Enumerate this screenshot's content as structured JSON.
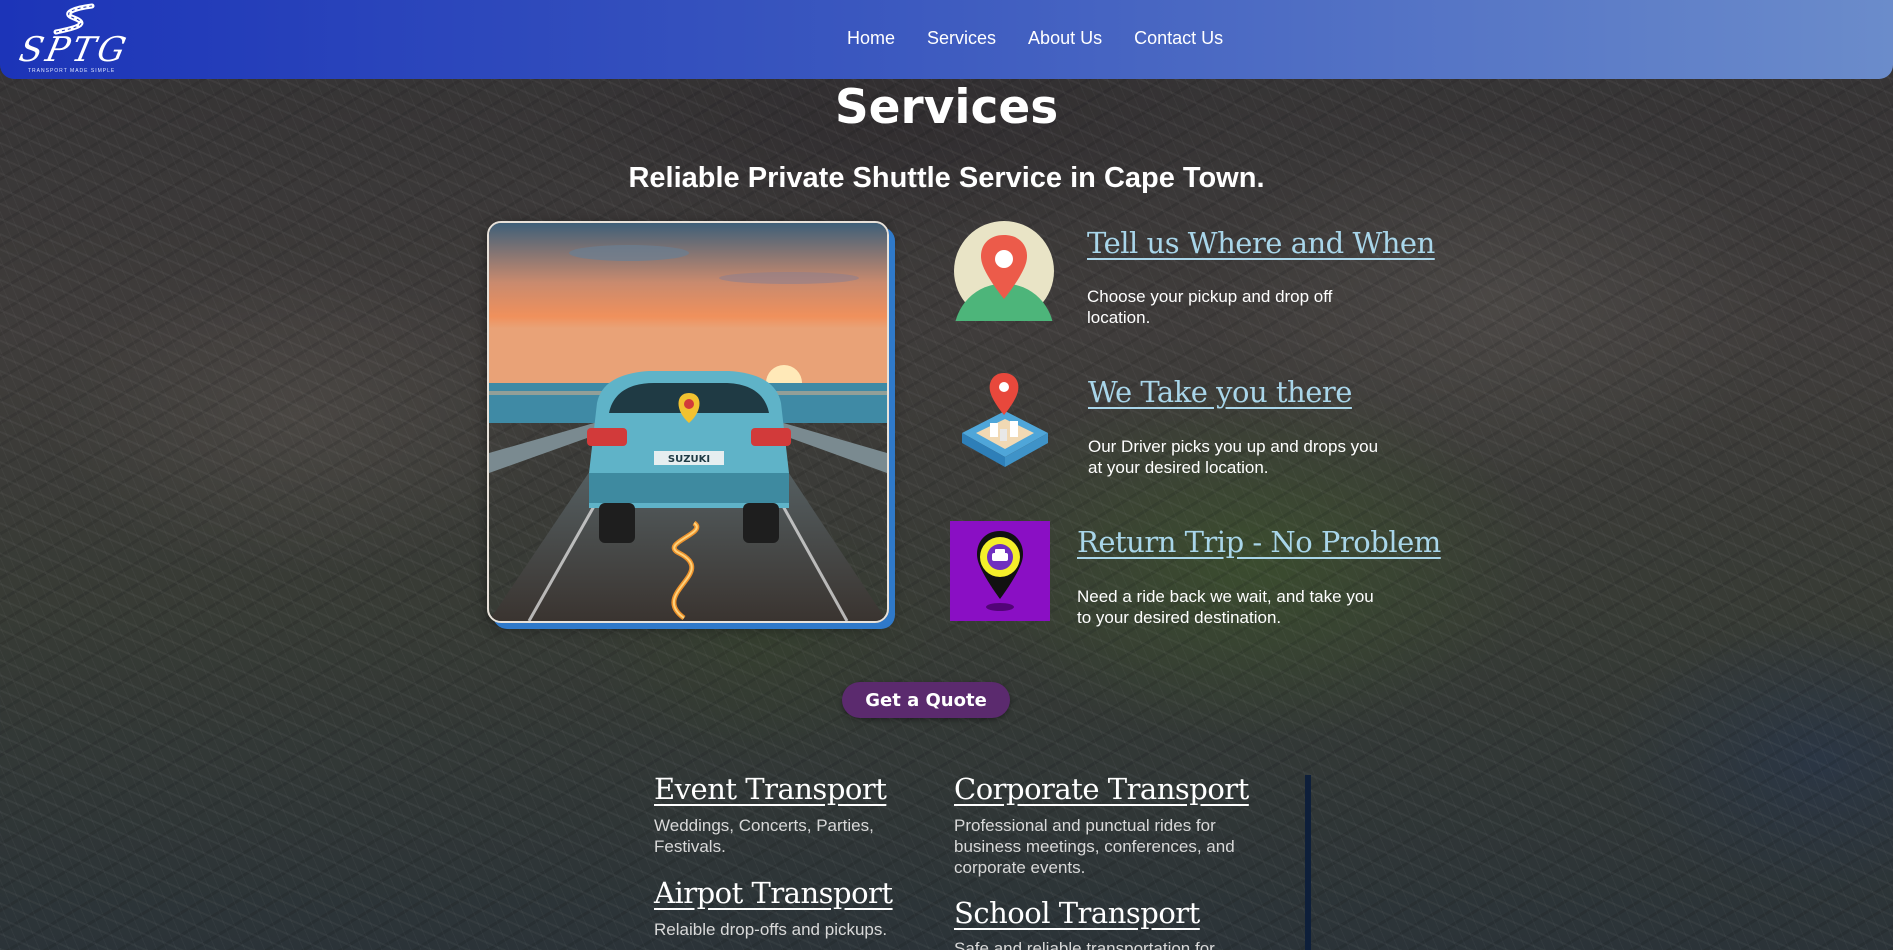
{
  "nav": {
    "logo": {
      "word": "SPTG",
      "tagline": "TRANSPORT MADE SIMPLE"
    },
    "links": [
      "Home",
      "Services",
      "About Us",
      "Contact Us"
    ]
  },
  "page": {
    "title": "Services",
    "tagline": "Reliable Private Shuttle Service in Cape Town."
  },
  "steps": [
    {
      "title": "Tell us Where and When",
      "text": "Choose your pickup and drop off location.",
      "icon": "location-pin-icon"
    },
    {
      "title": "We Take you there",
      "text": "Our Driver picks you up and drops you at your desired location.",
      "icon": "map-pin-city-icon"
    },
    {
      "title": "Return Trip - No Problem",
      "text": "Need a ride back we wait, and take you to your desired destination.",
      "icon": "car-pin-icon"
    }
  ],
  "photo": {
    "plate_text": "SUZUKI"
  },
  "cta": {
    "label": "Get a Quote"
  },
  "services": [
    {
      "title": "Event Transport",
      "text": "Weddings, Concerts, Parties, Festivals."
    },
    {
      "title": "Corporate Transport",
      "text": "Professional and punctual rides for business meetings, conferences, and corporate events."
    },
    {
      "title": "Airpot Transport",
      "text": "Relaible drop-offs and pickups."
    },
    {
      "title": "School Transport",
      "text": "Safe and reliable transportation for"
    }
  ],
  "colors": {
    "nav_start": "#1c34b8",
    "nav_end": "#6b8ccb",
    "step_title": "#a9d6ea",
    "button": "#5b2a6e",
    "card_shadow": "#2f79c9"
  }
}
